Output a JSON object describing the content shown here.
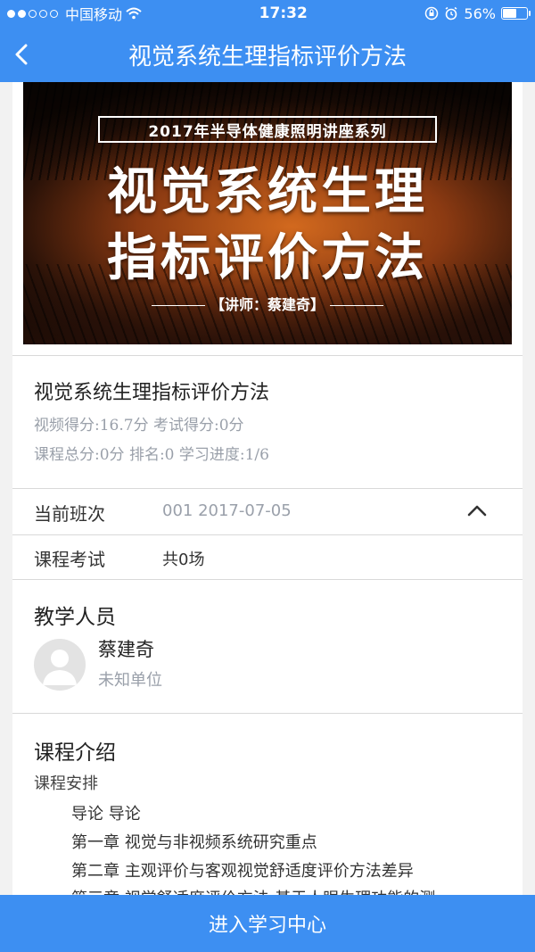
{
  "status_bar": {
    "carrier": "中国移动",
    "time": "17:32",
    "battery": "56%",
    "battery_level": 0.56
  },
  "nav": {
    "title": "视觉系统生理指标评价方法"
  },
  "banner": {
    "series": "2017年半导体健康照明讲座系列",
    "title_line1": "视觉系统生理",
    "title_line2": "指标评价方法",
    "lecturer": "【讲师：蔡建奇】"
  },
  "course": {
    "title": "视觉系统生理指标评价方法",
    "meta_line1": "视频得分:16.7分  考试得分:0分",
    "meta_line2": "课程总分:0分  排名:0  学习进度:1/6"
  },
  "class_row": {
    "label": "当前班次",
    "value": "001 2017-07-05"
  },
  "exam_row": {
    "label": "课程考试",
    "value": "共0场"
  },
  "teachers": {
    "title": "教学人员",
    "items": [
      {
        "name": "蔡建奇",
        "org": "未知单位"
      }
    ]
  },
  "intro": {
    "title": "课程介绍",
    "subtitle": "课程安排",
    "outline": [
      "导论 导论",
      "第一章 视觉与非视频系统研究重点",
      "第二章 主观评价与客观视觉舒适度评价方法差异",
      "第三章 视觉舒适度评价方法-基于人眼生理功能的测"
    ]
  },
  "footer": {
    "enter_label": "进入学习中心"
  },
  "colors": {
    "primary": "#3d8ff2",
    "muted_text": "#9aa0aa"
  }
}
